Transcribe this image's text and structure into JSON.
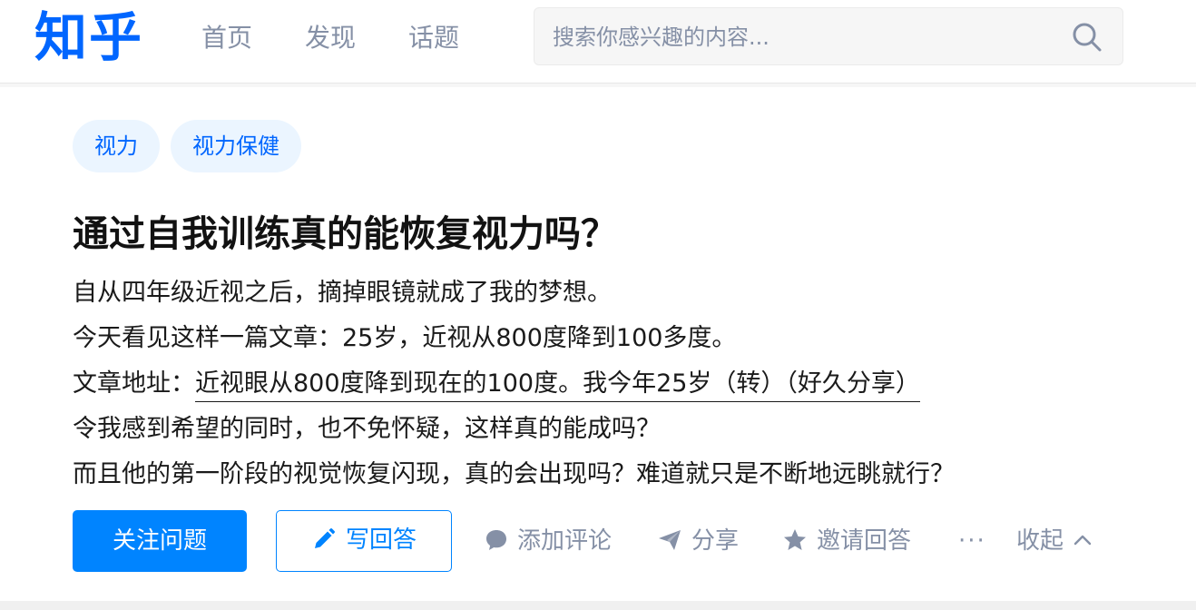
{
  "header": {
    "logo": "知乎",
    "nav": [
      "首页",
      "发现",
      "话题"
    ],
    "search_placeholder": "搜索你感兴趣的内容..."
  },
  "question": {
    "tags": [
      "视力",
      "视力保健"
    ],
    "title": "通过自我训练真的能恢复视力吗？",
    "lines": {
      "l1": "自从四年级近视之后，摘掉眼镜就成了我的梦想。",
      "l2": "今天看见这样一篇文章：25岁，近视从800度降到100多度。",
      "l3_prefix": "文章地址：",
      "l3_link": "近视眼从800度降到现在的100度。我今年25岁（转）（好久分享）",
      "l4": "令我感到希望的同时，也不免怀疑，这样真的能成吗？",
      "l5": "而且他的第一阶段的视觉恢复闪现，真的会出现吗？难道就只是不断地远眺就行？"
    }
  },
  "actions": {
    "follow": "关注问题",
    "answer": "写回答",
    "comment": "添加评论",
    "share": "分享",
    "invite": "邀请回答",
    "more": "···",
    "collapse": "收起"
  },
  "colors": {
    "brand": "#0066ff",
    "button": "#0084ff",
    "tag_bg": "#ebf5ff",
    "muted": "#8590a6"
  },
  "icons": [
    "search-icon",
    "pencil-icon",
    "comment-icon",
    "share-icon",
    "star-icon",
    "chevron-up-icon"
  ]
}
